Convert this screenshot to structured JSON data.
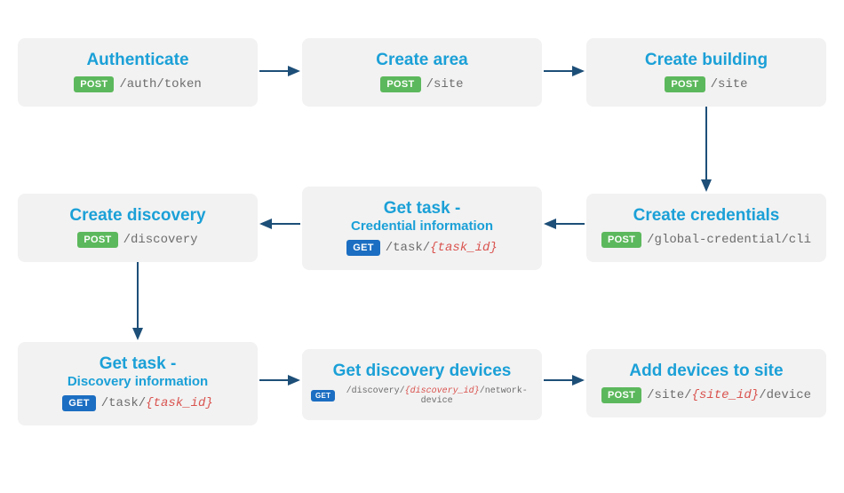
{
  "nodes": {
    "authenticate": {
      "title": "Authenticate",
      "method": "POST",
      "path": "/auth/token"
    },
    "create_area": {
      "title": "Create area",
      "method": "POST",
      "path": "/site"
    },
    "create_building": {
      "title": "Create building",
      "method": "POST",
      "path": "/site"
    },
    "create_credentials": {
      "title": "Create credentials",
      "method": "POST",
      "path": "/global-credential/cli"
    },
    "get_task_credential": {
      "title": "Get task -",
      "subtitle": "Credential information",
      "method": "GET",
      "path_prefix": "/task/",
      "path_var": "{task_id}"
    },
    "create_discovery": {
      "title": "Create discovery",
      "method": "POST",
      "path": "/discovery"
    },
    "get_task_discovery": {
      "title": "Get task -",
      "subtitle": "Discovery information",
      "method": "GET",
      "path_prefix": "/task/",
      "path_var": "{task_id}"
    },
    "get_discovery_devices": {
      "title": "Get discovery devices",
      "method": "GET",
      "path_prefix": "/discovery/",
      "path_var": "{discovery_id}",
      "path_suffix": "/network-device"
    },
    "add_devices_to_site": {
      "title": "Add devices to site",
      "method": "POST",
      "path_prefix": "/site/",
      "path_var": "{site_id}",
      "path_suffix": "/device"
    }
  },
  "flow_order": [
    "authenticate",
    "create_area",
    "create_building",
    "create_credentials",
    "get_task_credential",
    "create_discovery",
    "get_task_discovery",
    "get_discovery_devices",
    "add_devices_to_site"
  ],
  "colors": {
    "node_bg": "#f2f2f2",
    "title": "#1ba0d7",
    "post": "#5cb85c",
    "get": "#1b6ec2",
    "path": "#6d6d6d",
    "path_var": "#d9534f",
    "arrow": "#1d4f78"
  }
}
